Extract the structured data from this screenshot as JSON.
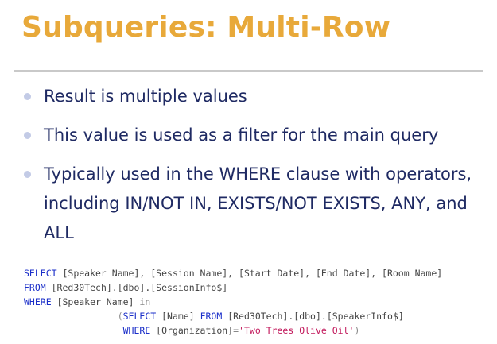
{
  "slide": {
    "title": "Subqueries: Multi-Row",
    "bullets": [
      "Result is multiple values",
      "This value is used as a filter for the main query",
      "Typically used in the WHERE clause with operators, including IN/NOT IN, EXISTS/NOT EXISTS, ANY, and ALL"
    ]
  },
  "code": {
    "line1": {
      "kw": "SELECT",
      "rest": " [Speaker Name], [Session Name], [Start Date], [End Date], [Room Name]"
    },
    "line2": {
      "kw": "FROM",
      "rest": " [Red30Tech].[dbo].[SessionInfo$]"
    },
    "line3": {
      "kw": "WHERE",
      "rest": " [Speaker Name] ",
      "op": "in"
    },
    "line4": {
      "indent": "                 ",
      "paren": "(",
      "kw1": "SELECT",
      "mid": " [Name] ",
      "kw2": "FROM",
      "rest": " [Red30Tech].[dbo].[SpeakerInfo$]"
    },
    "line5": {
      "indent": "                  ",
      "kw": "WHERE",
      "mid": " [Organization]",
      "eq": "=",
      "str": "'Two Trees Olive Oil'",
      "close": ")"
    }
  },
  "colors": {
    "title": "#E8A93A",
    "body_text": "#1f2a63",
    "bullet_dot": "#c3cbe6",
    "sql_keyword": "#1a2ec9",
    "sql_string": "#c2185b",
    "sql_operator": "#888888"
  }
}
